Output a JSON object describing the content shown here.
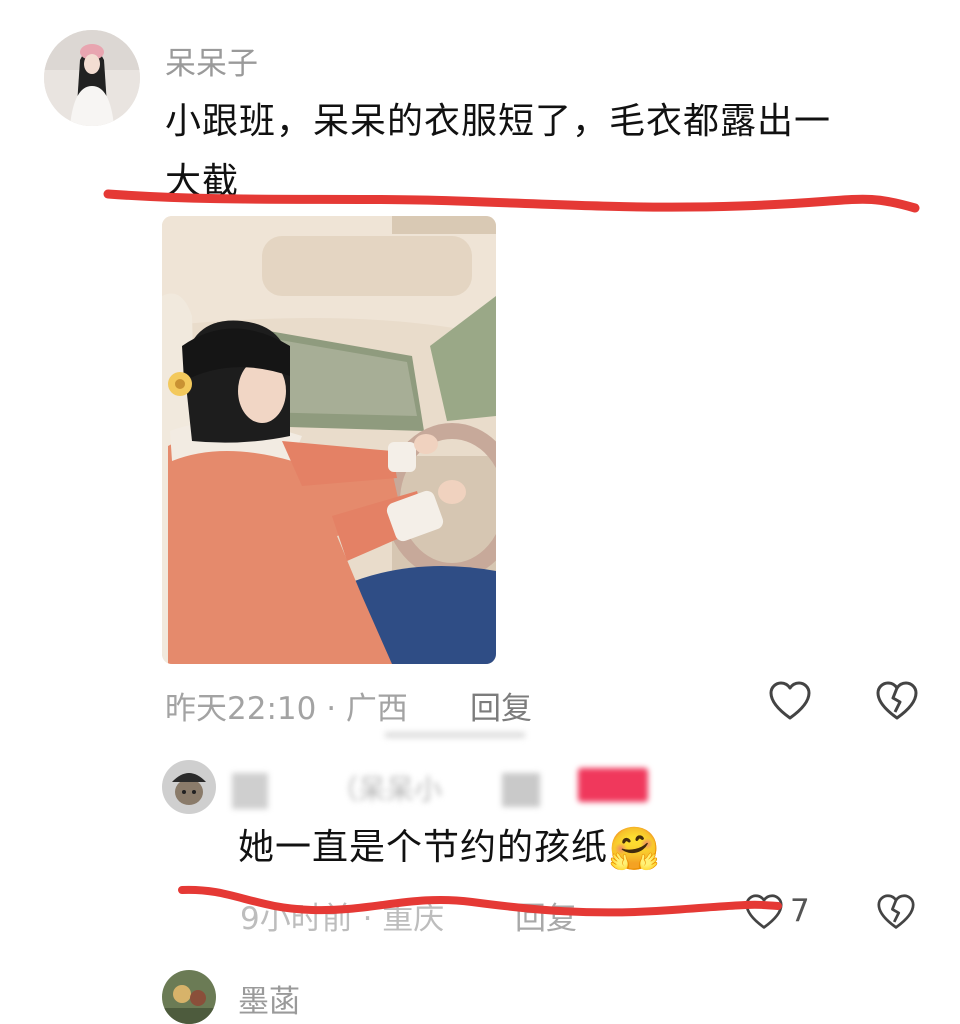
{
  "main_comment": {
    "username": "呆呆子",
    "text_line1": "小跟班，呆呆的衣服短了，毛衣都露出一",
    "text_line2": "大截",
    "time_location": "昨天22:10 · 广西",
    "reply_label": "回复"
  },
  "reply_comment": {
    "username_partial": "（呆呆小",
    "text": "她一直是个节约的孩纸",
    "emoji": "🤗",
    "time_location": "9小时前 · 重庆",
    "reply_label": "回复",
    "like_count": "7"
  },
  "third_comment": {
    "username": "墨菡"
  },
  "colors": {
    "annotation_red": "#e53935",
    "username_gray": "#9a9a9a",
    "meta_gray": "#a3a3a3",
    "coat": "#e58a6c",
    "badge_pink": "#f0385c"
  },
  "icons": [
    "heart-outline-icon",
    "broken-heart-icon"
  ]
}
